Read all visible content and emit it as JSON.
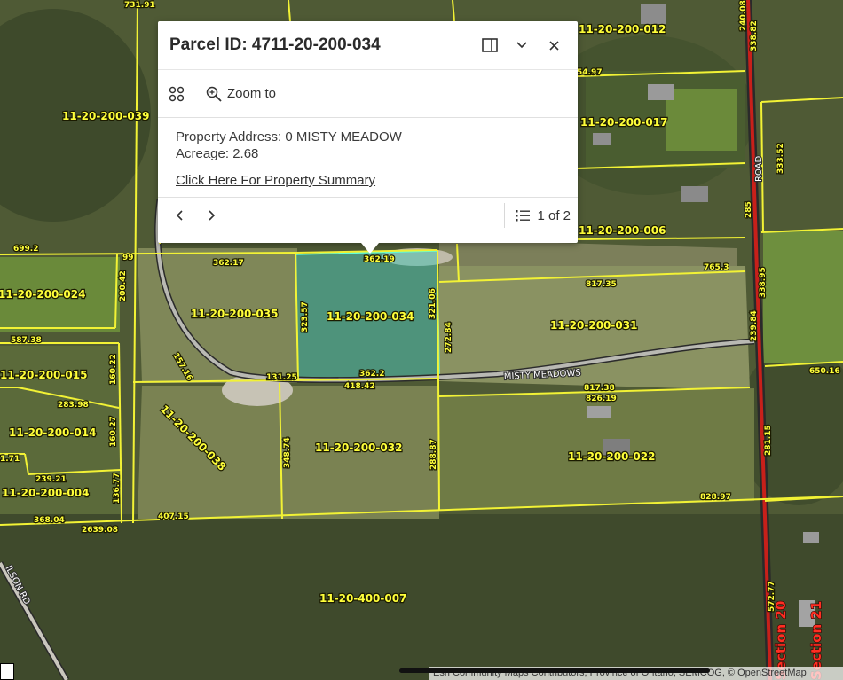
{
  "popup": {
    "title": "Parcel ID: 4711-20-200-034",
    "zoom_label": "Zoom to",
    "address": "Property Address: 0 MISTY MEADOW",
    "acreage": "Acreage: 2.68",
    "link": "Click Here For Property Summary",
    "pager": "1 of 2"
  },
  "map": {
    "parcels": {
      "p012": "11-20-200-012",
      "p039": "11-20-200-039",
      "p017": "11-20-200-017",
      "p024": "11-20-200-024",
      "p006": "11-20-200-006",
      "p035": "11-20-200-035",
      "p034": "11-20-200-034",
      "p031": "11-20-200-031",
      "p015": "11-20-200-015",
      "p014": "11-20-200-014",
      "p038": "11-20-200-038",
      "p032": "11-20-200-032",
      "p022": "11-20-200-022",
      "p004": "11-20-200-004",
      "p007": "11-20-400-007"
    },
    "dims": {
      "d1": "731.91",
      "d2": "54.97",
      "d3": "699.2",
      "d4": "99",
      "d5": "362.17",
      "d6": "362.19",
      "d7": "765.3",
      "d8": "817.35",
      "d9": "587.38",
      "d10": "131.25",
      "d11": "418.42",
      "d12": "362.2",
      "d13": "817.38",
      "d14": "826.19",
      "d15": "283.98",
      "d16": "239.21",
      "d17": "368.04",
      "d18": "407.15",
      "d19": "2639.08",
      "d20": "828.97",
      "d21": "650.16",
      "d22": "323.57",
      "d23": "321.06",
      "d24": "272.84",
      "d25": "348.74",
      "d26": "288.87",
      "d27": "200.42",
      "d28": "160.22",
      "d29": "160.27",
      "d30": "157.16",
      "d31": "136.77",
      "d32": "281.15",
      "d33": "338.95",
      "d34": "239.84",
      "d35": "333.52",
      "d36": "338.82",
      "d37": "240.08",
      "d38": "572.77",
      "d39": "1.71",
      "d40": "285"
    },
    "roads": {
      "misty": "MISTY MEADOWS",
      "road": "ROAD",
      "wilson": "ILSON RD"
    },
    "sections": {
      "s20": "Section 20",
      "s21": "Section 21"
    },
    "attribution": "Esri Community Maps Contributors, Province of Ontario, SEMCOG, © OpenStreetMap"
  },
  "icons": [
    "actions-icon",
    "zoom-icon",
    "dock-icon",
    "collapse-icon",
    "close-icon",
    "previous-icon",
    "next-icon",
    "list-icon"
  ]
}
